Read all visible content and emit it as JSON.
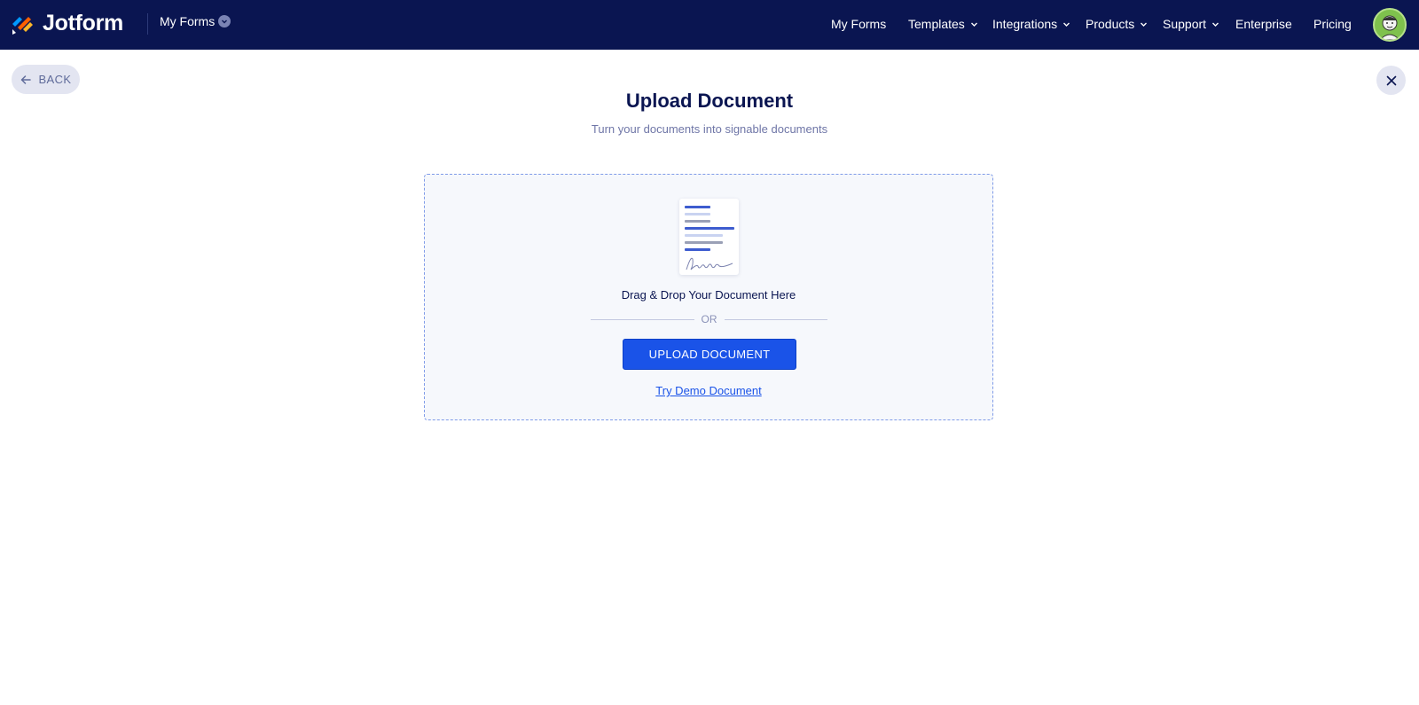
{
  "header": {
    "brand": "Jotform",
    "my_forms_dropdown": "My Forms",
    "nav": [
      {
        "label": "My Forms",
        "has_dropdown": false
      },
      {
        "label": "Templates",
        "has_dropdown": true
      },
      {
        "label": "Integrations",
        "has_dropdown": true
      },
      {
        "label": "Products",
        "has_dropdown": true
      },
      {
        "label": "Support",
        "has_dropdown": true
      },
      {
        "label": "Enterprise",
        "has_dropdown": false
      },
      {
        "label": "Pricing",
        "has_dropdown": false
      }
    ],
    "avatar_icon": "user-avatar-icon"
  },
  "back_label": "BACK",
  "title": "Upload Document",
  "subtitle": "Turn your documents into signable documents",
  "dropzone": {
    "drop_text": "Drag & Drop Your Document Here",
    "or_text": "OR",
    "upload_button": "UPLOAD DOCUMENT",
    "demo_link": "Try Demo Document"
  },
  "colors": {
    "nav_bg": "#0a1551",
    "primary": "#1a53e8",
    "dropzone_border": "#7f9be8",
    "dropzone_bg": "#f6f8fc"
  }
}
